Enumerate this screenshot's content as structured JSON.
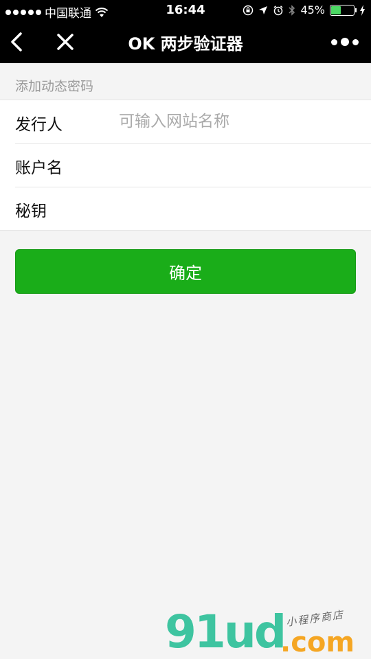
{
  "status_bar": {
    "carrier": "中国联通",
    "time": "16:44",
    "battery_percent": "45%",
    "battery_level": 0.45,
    "icons": [
      "signal-dots-icon",
      "wifi-icon",
      "orientation-lock-icon",
      "location-arrow-icon",
      "alarm-clock-icon",
      "bluetooth-icon",
      "battery-icon",
      "charging-bolt-icon"
    ]
  },
  "nav": {
    "title": "OK 两步验证器",
    "icons": [
      "back-chevron-icon",
      "close-x-icon",
      "more-dots-icon"
    ]
  },
  "form": {
    "section_title": "添加动态密码",
    "fields": [
      {
        "label": "发行人",
        "placeholder": "可输入网站名称",
        "value": ""
      },
      {
        "label": "账户名",
        "placeholder": "",
        "value": ""
      },
      {
        "label": "秘钥",
        "placeholder": "",
        "value": ""
      }
    ],
    "submit_label": "确定"
  },
  "watermark": {
    "brand": "91ud",
    "domain": ".com",
    "tagline": "小程序商店"
  },
  "colors": {
    "bar_background": "#000000",
    "page_background": "#f4f4f4",
    "primary_button": "#1aad19",
    "battery_fill": "#4cd964",
    "watermark_main": "#3ec4a0",
    "watermark_domain": "#f5a623"
  }
}
